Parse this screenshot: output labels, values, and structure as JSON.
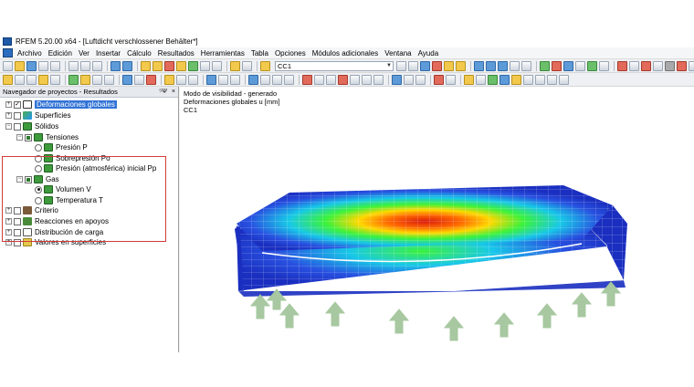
{
  "window": {
    "title": "RFEM 5.20.00 x64 - [Luftdicht verschlossener Behälter*]"
  },
  "menu": {
    "items": [
      "Archivo",
      "Edición",
      "Ver",
      "Insertar",
      "Cálculo",
      "Resultados",
      "Herramientas",
      "Tabla",
      "Opciones",
      "Módulos adicionales",
      "Ventana",
      "Ayuda"
    ]
  },
  "toolbar": {
    "load_case": "CC1"
  },
  "navigator": {
    "title": "Navegador de proyectos - Resultados",
    "pin_glyph": "⁵Ψ",
    "close_glyph": "×",
    "items": [
      {
        "label": "Deformaciones globales",
        "selected": true
      },
      {
        "label": "Superficies"
      },
      {
        "label": "Sólidos"
      },
      {
        "label": "Tensiones"
      },
      {
        "label": "Presión P"
      },
      {
        "label": "Sobrepresión Po"
      },
      {
        "label": "Presión (atmosférica) inicial Pp"
      },
      {
        "label": "Gas"
      },
      {
        "label": "Volumen V"
      },
      {
        "label": "Temperatura T"
      },
      {
        "label": "Criterio"
      },
      {
        "label": "Reacciones en apoyos"
      },
      {
        "label": "Distribución de carga"
      },
      {
        "label": "Valores en superficies"
      }
    ]
  },
  "view": {
    "info_line1": "Modo de visibilidad - generado",
    "info_line2": "Deformaciones globales u [mm]",
    "info_line3": "CC1"
  },
  "colors": {
    "selection": "#3173d6",
    "highlight_box": "#d23b3b",
    "mesh_blue": "#1a2fc0",
    "support_green": "#a7c8a0"
  }
}
